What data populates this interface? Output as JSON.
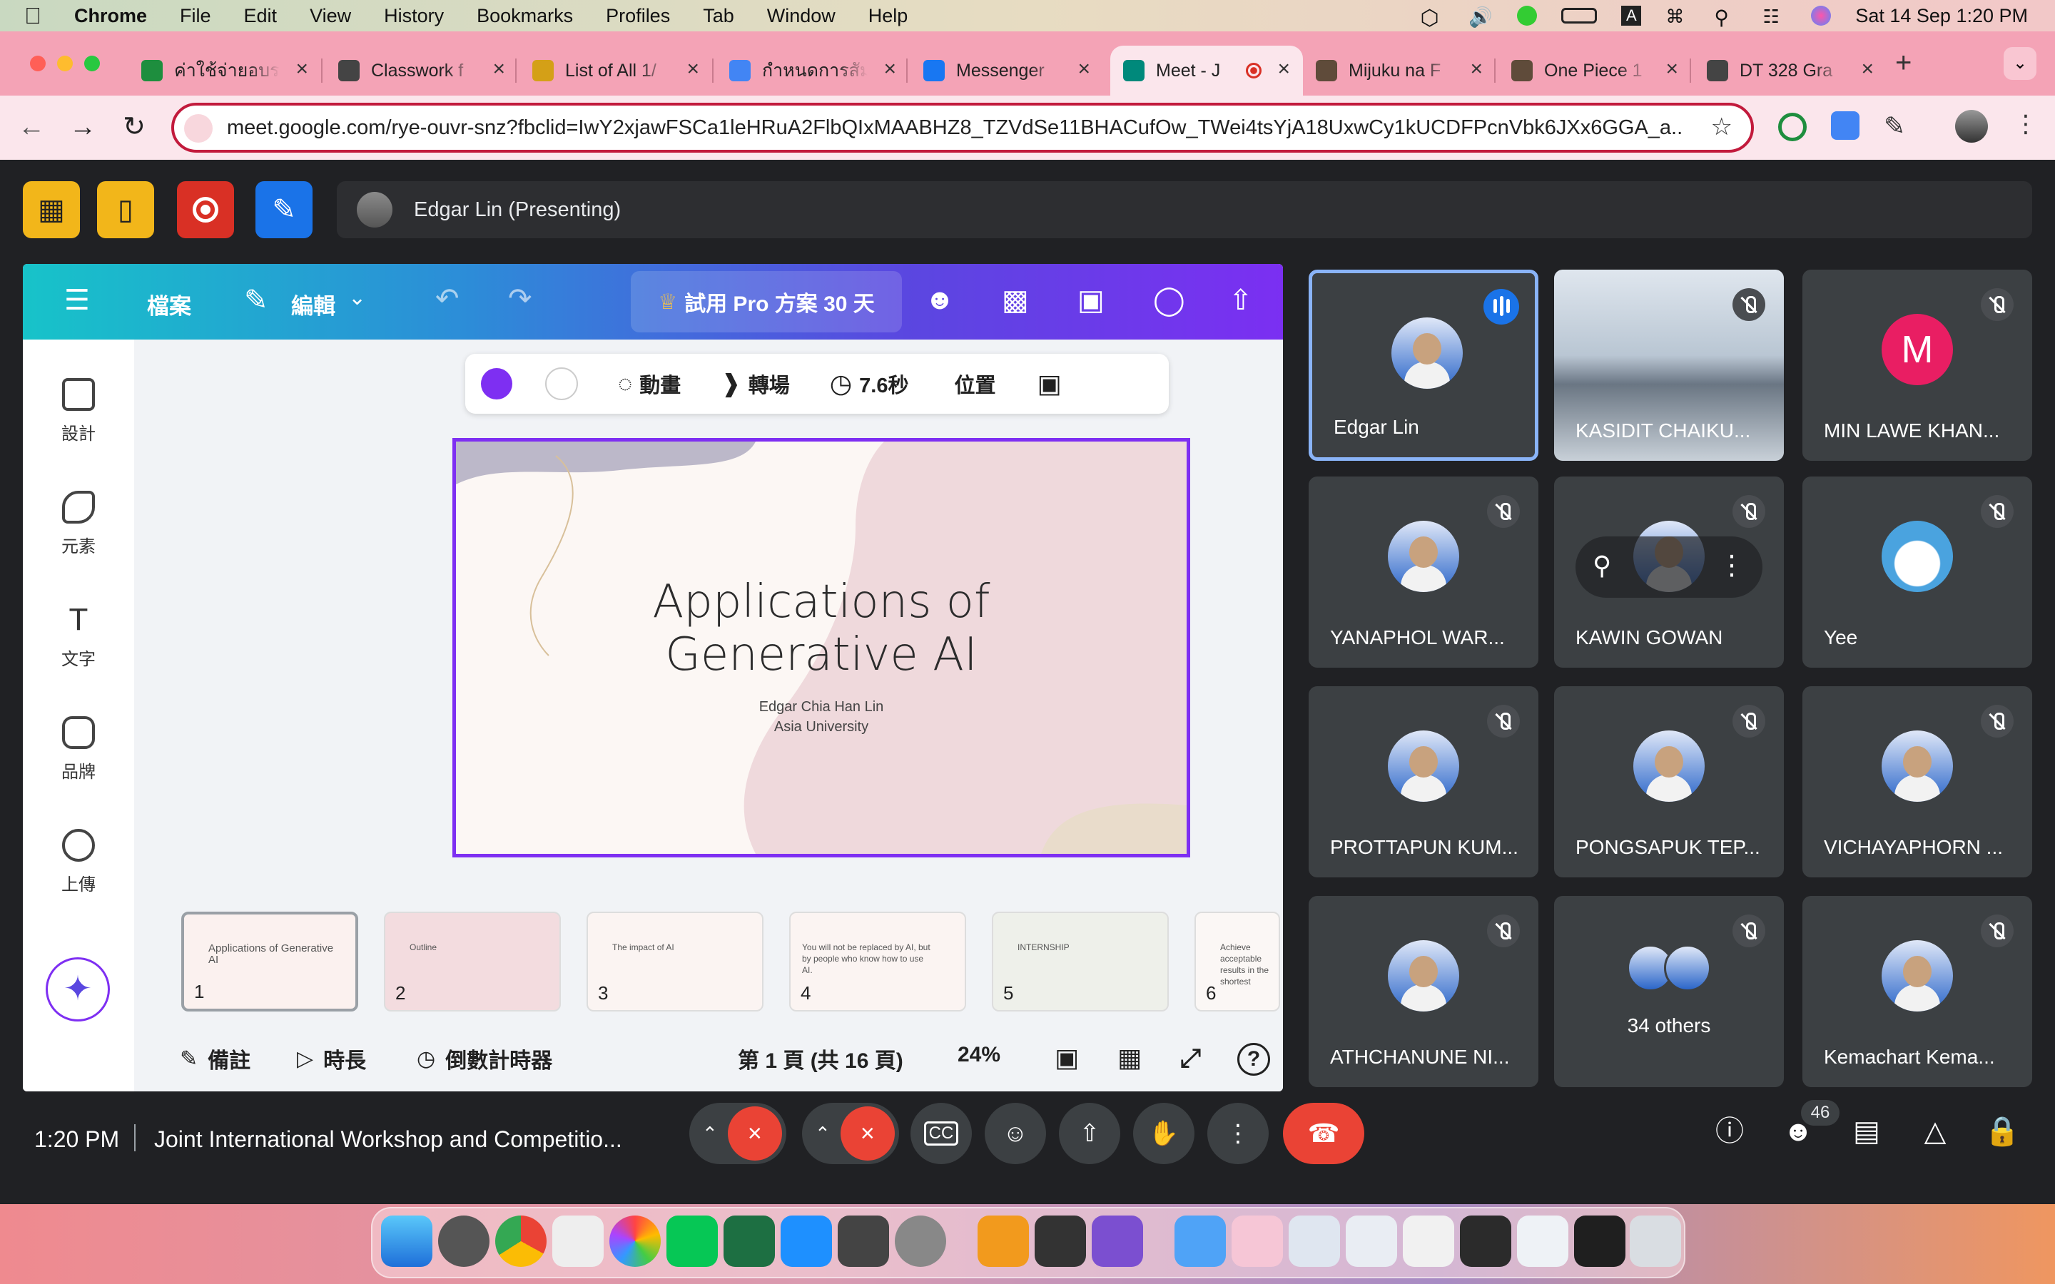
{
  "menubar": {
    "app_name": "Chrome",
    "menus": [
      "File",
      "Edit",
      "View",
      "History",
      "Bookmarks",
      "Profiles",
      "Tab",
      "Window",
      "Help"
    ],
    "datetime": "Sat 14 Sep  1:20 PM",
    "input_source": "A",
    "status_icons": [
      "unity-icon",
      "volume-icon",
      "line-icon",
      "battery-icon",
      "input-source-icon",
      "wifi-icon",
      "spotlight-icon",
      "control-center-icon",
      "siri-icon"
    ]
  },
  "tabs": [
    {
      "title": "ค่าใช้จ่ายอบรม",
      "favicon_color": "#1e8e3e"
    },
    {
      "title": "Classwork f",
      "favicon_color": "#444444"
    },
    {
      "title": "List of All 1/",
      "favicon_color": "#d4a017"
    },
    {
      "title": "กำหนดการสัม",
      "favicon_color": "#4285f4"
    },
    {
      "title": "Messenger",
      "favicon_color": "#1877f2"
    },
    {
      "title": "Meet - J",
      "favicon_color": "#00897b",
      "active": true
    },
    {
      "title": "Mijuku na F",
      "favicon_color": "#5f4b3a"
    },
    {
      "title": "One Piece 1",
      "favicon_color": "#5f4b3a"
    },
    {
      "title": "DT 328 Gra",
      "favicon_color": "#444444"
    }
  ],
  "new_tab_label": "+",
  "address": {
    "url": "meet.google.com/rye-ouvr-snz?fbclid=IwY2xjawFSCa1leHRuA2FlbQIxMAABHZ8_TZVdSe11BHACufOw_TWei4tsYjA18UxwCy1kUCDFPcnVbk6JXx6GGA_a..."
  },
  "meet": {
    "presenter_label": "Edgar Lin (Presenting)",
    "time": "1:20 PM",
    "meeting_title": "Joint International Workshop and Competitio...",
    "participant_count": "46",
    "colors": {
      "bg": "#202124",
      "tile": "#3c4043",
      "end_call": "#ea4335",
      "speaking": "#8ab4f8"
    }
  },
  "canva": {
    "menu": {
      "file": "檔案",
      "edit": "編輯",
      "trial": "試用 Pro 方案 30 天"
    },
    "sidebar": [
      {
        "label": "設計",
        "icon": "layout-icon"
      },
      {
        "label": "元素",
        "icon": "shapes-icon"
      },
      {
        "label": "文字",
        "icon": "text-icon"
      },
      {
        "label": "品牌",
        "icon": "brand-icon"
      },
      {
        "label": "上傳",
        "icon": "upload-cloud-icon"
      }
    ],
    "context_bar": {
      "animate": "動畫",
      "transition": "轉場",
      "duration": "7.6秒",
      "position": "位置"
    },
    "slide": {
      "title_line1": "Applications of",
      "title_line2": "Generative AI",
      "subtitle_line1": "Edgar Chia Han Lin",
      "subtitle_line2": "Asia University"
    },
    "thumbnails": [
      {
        "num": "1",
        "text": "Applications of Generative AI"
      },
      {
        "num": "2",
        "text": "Outline"
      },
      {
        "num": "3",
        "text": "The impact of AI"
      },
      {
        "num": "4",
        "text": "You will not be replaced by AI, but by people who know how to use AI."
      },
      {
        "num": "5",
        "text": "INTERNSHIP"
      },
      {
        "num": "6",
        "text": "Achieve acceptable results in the shortest possible time."
      }
    ],
    "bottom": {
      "notes": "備註",
      "duration": "時長",
      "timer": "倒數計時器",
      "page": "第 1 頁 (共 16 頁)",
      "zoom": "24%"
    },
    "accent": "#7e2ff2"
  },
  "participants": [
    {
      "name": "Edgar Lin",
      "avatar": "photo",
      "speaking": true
    },
    {
      "name": "KASIDIT CHAIKU...",
      "avatar": "video"
    },
    {
      "name": "MIN LAWE KHAN...",
      "avatar": "letter",
      "letter": "M",
      "color": "#e91e63"
    },
    {
      "name": "YANAPHOL WAR...",
      "avatar": "photo"
    },
    {
      "name": "KAWIN GOWAN",
      "avatar": "photo",
      "hovered": true
    },
    {
      "name": "Yee",
      "avatar": "cartoon"
    },
    {
      "name": "PROTTAPUN KUM...",
      "avatar": "photo"
    },
    {
      "name": "PONGSAPUK TEP...",
      "avatar": "photo"
    },
    {
      "name": "VICHAYAPHORN ...",
      "avatar": "photo"
    },
    {
      "name": "ATHCHANUNE NI...",
      "avatar": "photo"
    },
    {
      "name": "34 others",
      "avatar": "group"
    },
    {
      "name": "Kemachart Kema...",
      "avatar": "photo"
    }
  ]
}
